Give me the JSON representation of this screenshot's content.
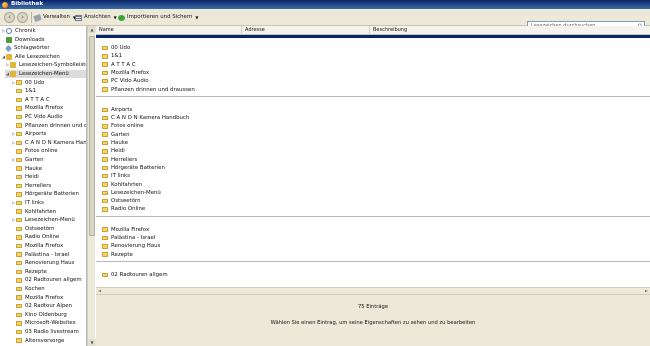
{
  "window": {
    "title": "Bibliothek"
  },
  "toolbar": {
    "back_icon": "back-arrow-icon",
    "forward_icon": "forward-arrow-icon",
    "organize_label": "Verwalten",
    "views_label": "Ansichten",
    "import_label": "Importieren und Sichern",
    "search_placeholder": "Lesezeichen durchsuchen"
  },
  "sidebar": {
    "top": [
      {
        "label": "Chronik",
        "icon": "clock-icon"
      },
      {
        "label": "Downloads",
        "icon": "download-icon"
      },
      {
        "label": "Schlagwörter",
        "icon": "tag-icon"
      },
      {
        "label": "Alle Lesezeichen",
        "icon": "star-icon"
      }
    ],
    "children": [
      {
        "label": "Lesezeichen-Symbolleiste"
      },
      {
        "label": "Lesezeichen-Menü"
      }
    ],
    "folders": [
      "00 Udo",
      "1&1",
      "A T T A C",
      "Mozilla Firefox",
      "PC Vido Audio",
      "Pflanzen drinnen und dr...",
      "Airports",
      "C A N O N Kamera Han...",
      "Fotos online",
      "Garten",
      "Hauke",
      "Heidi",
      "Herrellers",
      "Hörgeräte Batterien",
      "IT links",
      "Kohlfahrten",
      "Lesezeichen-Menü",
      "Ostseetörn",
      "Radio Online",
      "Mozilla Firefox",
      "Palästina - Israel",
      "Renovierung Haus",
      "Rezepte",
      "02 Radtouren allgem",
      "Kochen",
      "Mozilla Firefox",
      "02 Radtour Alpen",
      "Kino Oldenburg",
      "Microsoft-Websites",
      "03 Radio livestream",
      "Altersvorsorge"
    ]
  },
  "columns": {
    "name": "Name",
    "address": "Adresse",
    "description": "Beschreibung"
  },
  "groups": [
    [
      "00 Udo",
      "1&1",
      "A T T A C",
      "Mozilla Firefox",
      "PC Vido Audio",
      "Pflanzen drinnen und draussen"
    ],
    [
      "Airports",
      "C A N O N Kamera Handbuch",
      "Fotos online",
      "Garten",
      "Hauke",
      "Heidi",
      "Herrellers",
      "Hörgeräte Batterien",
      "IT links",
      "Kohlfahrten",
      "Lesezeichen-Menü",
      "Ostseetörn",
      "Radio Online"
    ],
    [
      "Mozilla Firefox",
      "Palästina - Israel",
      "Renovierung Haus",
      "Rezepte"
    ],
    [
      "02 Radtouren allgem"
    ]
  ],
  "details": {
    "count": "75 Einträge",
    "hint": "Wählen Sie einen Eintrag, um seine Eigenschaften zu sehen und zu bearbeiten"
  }
}
